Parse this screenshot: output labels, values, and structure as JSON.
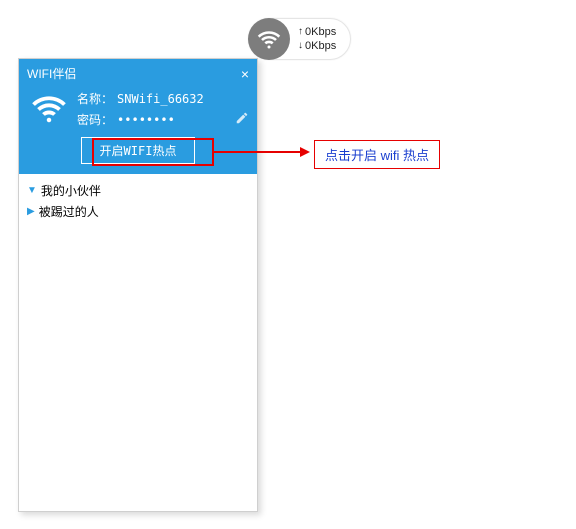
{
  "speed": {
    "up": "0Kbps",
    "down": "0Kbps"
  },
  "window": {
    "title": "WIFI伴侣",
    "name_label": "名称：",
    "name_value": "SNWifi_66632",
    "pwd_label": "密码：",
    "pwd_value": "••••••••",
    "open_button": "开启WIFI热点"
  },
  "tree": {
    "item1": "我的小伙伴",
    "item2": "被踢过的人"
  },
  "callout": {
    "text": "点击开启 wifi 热点"
  }
}
